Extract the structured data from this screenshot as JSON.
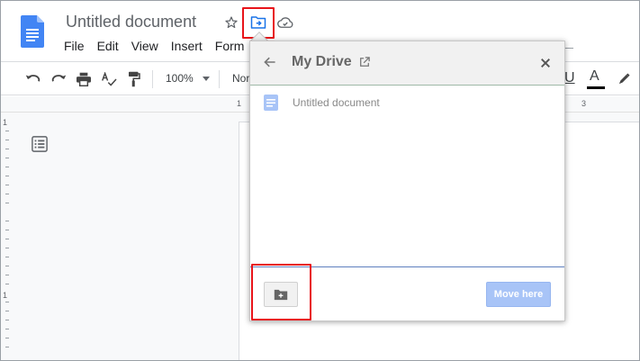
{
  "document": {
    "title": "Untitled document"
  },
  "header": {
    "icons": [
      "docs-logo-icon",
      "star-icon",
      "move-to-folder-icon",
      "cloud-saved-icon"
    ]
  },
  "menubar": {
    "items": [
      "File",
      "Edit",
      "View",
      "Insert",
      "Form"
    ]
  },
  "toolbar": {
    "zoom": "100%",
    "style": "Nor",
    "underline_label": "U",
    "text_color_label": "A",
    "icons": [
      "undo-icon",
      "redo-icon",
      "print-icon",
      "spellcheck-icon",
      "paint-format-icon",
      "highlight-pen-icon"
    ]
  },
  "ruler": {
    "h_marks": [
      "1",
      "3"
    ],
    "v_marks": [
      "1",
      "1"
    ]
  },
  "move_dialog": {
    "title": "My Drive",
    "items": [
      {
        "label": "Untitled document",
        "icon": "doc-file-icon"
      }
    ],
    "move_here_label": "Move here"
  },
  "colors": {
    "highlight_box": "#e8141a",
    "docs_blue": "#4285f4",
    "move_here_bg": "#a8c4f7",
    "dialog_header_bg": "#f1f1f1"
  }
}
